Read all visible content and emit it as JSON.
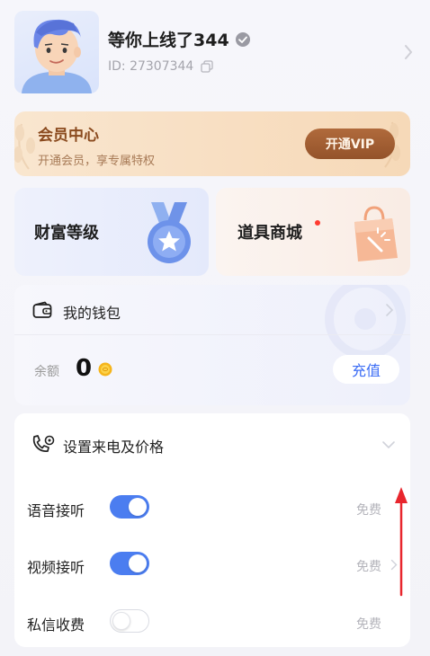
{
  "profile": {
    "username": "等你上线了344",
    "user_id": "ID: 27307344"
  },
  "vip": {
    "title": "会员中心",
    "subtitle": "开通会员，享专属特权",
    "button_label": "开通VIP"
  },
  "features": {
    "wealth_label": "财富等级",
    "shop_label": "道具商城",
    "shop_has_notification": true
  },
  "wallet": {
    "title": "我的钱包",
    "balance_label": "余额",
    "balance_value": "0",
    "recharge_label": "充值"
  },
  "call_settings": {
    "title": "设置来电及价格",
    "rows": [
      {
        "label": "语音接听",
        "enabled": true,
        "price": "免费"
      },
      {
        "label": "视频接听",
        "enabled": true,
        "price": "免费"
      },
      {
        "label": "私信收费",
        "enabled": false,
        "price": "免费"
      }
    ]
  },
  "colors": {
    "accent_blue": "#4b7df0",
    "vip_brown": "#94532a",
    "annotation_red": "#e8262d"
  }
}
